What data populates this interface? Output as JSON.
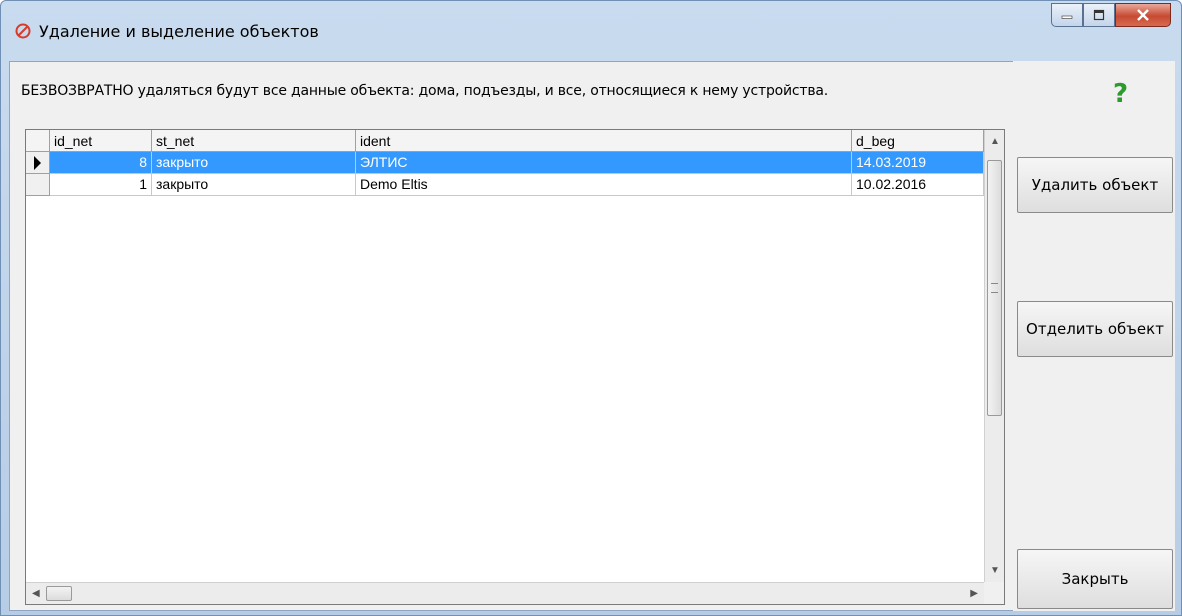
{
  "window": {
    "title": "Удаление и выделение объектов"
  },
  "info": {
    "text": "БЕЗВОЗВРАТНО удаляться будут все данные объекта: дома, подъезды, и все, относящиеся к нему устройства."
  },
  "help": {
    "label": "?"
  },
  "table": {
    "columns": [
      "id_net",
      "st_net",
      "ident",
      "d_beg"
    ],
    "rows": [
      {
        "id_net": "8",
        "st_net": "закрыто",
        "ident": "ЭЛТИС",
        "d_beg": "14.03.2019",
        "selected": true
      },
      {
        "id_net": "1",
        "st_net": "закрыто",
        "ident": "Demo Eltis",
        "d_beg": "10.02.2016",
        "selected": false
      }
    ]
  },
  "buttons": {
    "delete": "Удалить объект",
    "separate": "Отделить объект",
    "close": "Закрыть"
  },
  "colors": {
    "selection": "#3399ff",
    "help": "#2c9a2c",
    "close_button": "#c74a33"
  }
}
